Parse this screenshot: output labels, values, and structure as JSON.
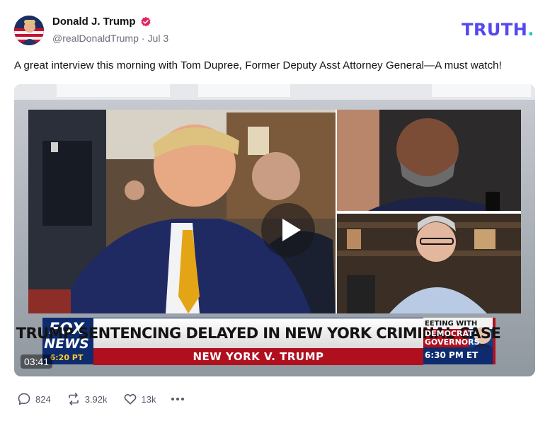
{
  "author": {
    "display_name": "Donald J. Trump",
    "handle": "@realDonaldTrump",
    "separator": "·",
    "date": "Jul 3",
    "verified_icon": "verified-badge-icon",
    "avatar_icon": "avatar-flag-portrait"
  },
  "brand": {
    "wordmark": "TRUTH",
    "dot": ".",
    "color": "#5448ee",
    "dot_color": "#1ec7b5"
  },
  "post": {
    "text": "A great interview this morning with Tom Dupree, Former Deputy Asst Attorney General—A must watch!"
  },
  "video": {
    "duration": "03:41",
    "play_icon": "play-icon",
    "chyron": {
      "network_line1": "FOX",
      "network_line2": "NEWS",
      "time_left": "6:20 PT",
      "headline": "TRUMP SENTENCING DELAYED IN NEW YORK CRIMINAL CASE",
      "subhead": "NEW YORK V. TRUMP",
      "promo_line1": "EETING WITH",
      "promo_line2": "DEMOCRAT",
      "promo_line3": "GOVERNORS",
      "promo_time": "6:30 PM ET"
    }
  },
  "actions": {
    "replies": "824",
    "retruths": "3.92k",
    "likes": "13k",
    "reply_icon": "comment-icon",
    "retruth_icon": "repost-icon",
    "like_icon": "heart-icon",
    "more_icon": "more-dots-icon"
  }
}
